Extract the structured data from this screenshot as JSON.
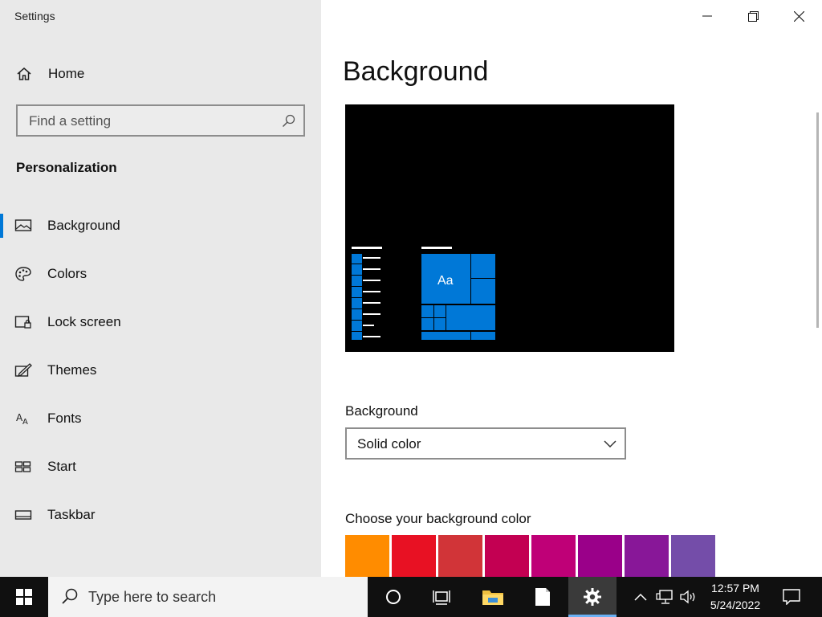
{
  "window": {
    "title": "Settings",
    "controls": {
      "minimize": "minimize-icon",
      "restore": "restore-icon",
      "close": "close-icon"
    }
  },
  "sidebar": {
    "home_label": "Home",
    "search_placeholder": "Find a setting",
    "section_title": "Personalization",
    "items": [
      {
        "label": "Background",
        "icon": "picture-icon",
        "active": true
      },
      {
        "label": "Colors",
        "icon": "palette-icon",
        "active": false
      },
      {
        "label": "Lock screen",
        "icon": "lock-screen-icon",
        "active": false
      },
      {
        "label": "Themes",
        "icon": "themes-icon",
        "active": false
      },
      {
        "label": "Fonts",
        "icon": "fonts-icon",
        "active": false
      },
      {
        "label": "Start",
        "icon": "start-icon",
        "active": false
      },
      {
        "label": "Taskbar",
        "icon": "taskbar-icon",
        "active": false
      }
    ]
  },
  "main": {
    "title": "Background",
    "preview": {
      "tile_text": "Aa",
      "accent_color": "#0078d7",
      "background_color": "#000000"
    },
    "background_label": "Background",
    "background_value": "Solid color",
    "color_label": "Choose your background color",
    "swatches": [
      "#ff8c00",
      "#e81123",
      "#d13438",
      "#c30052",
      "#bf0077",
      "#9a0089",
      "#881798",
      "#744da9"
    ]
  },
  "taskbar": {
    "search_placeholder": "Type here to search",
    "time": "12:57 PM",
    "date": "5/24/2022",
    "accent": "#6ab0f3"
  },
  "colors": {
    "sidebar_bg": "#e9e9e9",
    "accent": "#0078d7"
  }
}
